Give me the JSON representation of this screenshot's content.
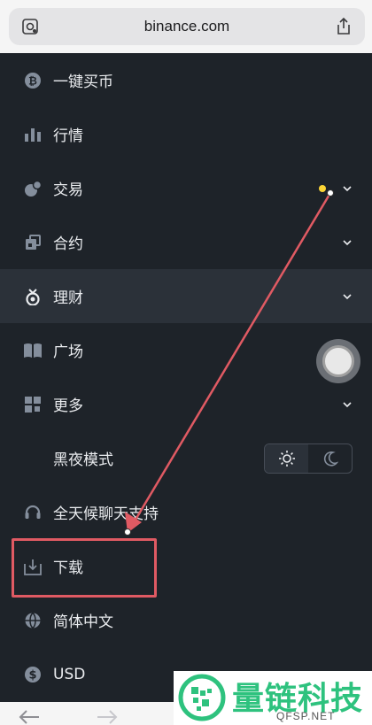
{
  "browser": {
    "url": "binance.com"
  },
  "menu": {
    "items": [
      {
        "label": "一键买币",
        "icon": "bitcoin-icon"
      },
      {
        "label": "行情",
        "icon": "bar-chart-icon"
      },
      {
        "label": "交易",
        "icon": "trade-icon"
      },
      {
        "label": "合约",
        "icon": "futures-icon"
      },
      {
        "label": "理财",
        "icon": "earn-icon"
      },
      {
        "label": "广场",
        "icon": "book-icon"
      },
      {
        "label": "更多",
        "icon": "grid-icon"
      },
      {
        "label": "黑夜模式"
      },
      {
        "label": "全天候聊天支持",
        "icon": "headset-icon"
      },
      {
        "label": "下载",
        "icon": "download-icon"
      },
      {
        "label": "简体中文",
        "icon": "globe-icon"
      },
      {
        "label": "USD",
        "icon": "dollar-icon"
      }
    ]
  },
  "theme": {
    "selected": "light"
  },
  "watermark": {
    "title": "量链科技",
    "subtitle": "QFSP.NET"
  },
  "colors": {
    "accent": "#fcd535",
    "annotation": "#e05a63",
    "brand_watermark": "#2ec27e"
  }
}
